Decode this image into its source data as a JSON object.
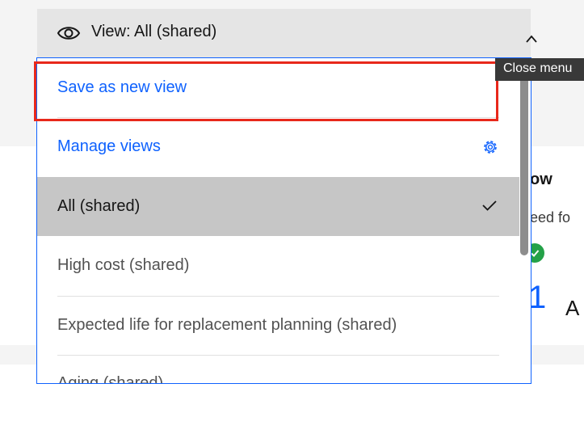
{
  "background": {
    "heading": "ow",
    "subtext": "eed fo",
    "big_number": "1",
    "trailing_letter": "A"
  },
  "view_selector": {
    "eye_icon": "eye-icon",
    "label": "View: All (shared)",
    "chevron_icon": "chevron-up-icon"
  },
  "menu": {
    "save_as_new": "Save as new view",
    "manage_views": "Manage views",
    "manage_icon": "gear-icon",
    "views": [
      {
        "label": "All (shared)",
        "selected": true
      },
      {
        "label": "High cost (shared)",
        "selected": false
      },
      {
        "label": "Expected life for replacement planning (shared)",
        "selected": false
      },
      {
        "label": "Aging (shared)",
        "selected": false
      }
    ]
  },
  "tooltip": {
    "text": "Close menu"
  },
  "colors": {
    "link": "#0f62fe",
    "selected_bg": "#c6c6c6",
    "highlight_border": "#e8281b",
    "success": "#24a148"
  }
}
